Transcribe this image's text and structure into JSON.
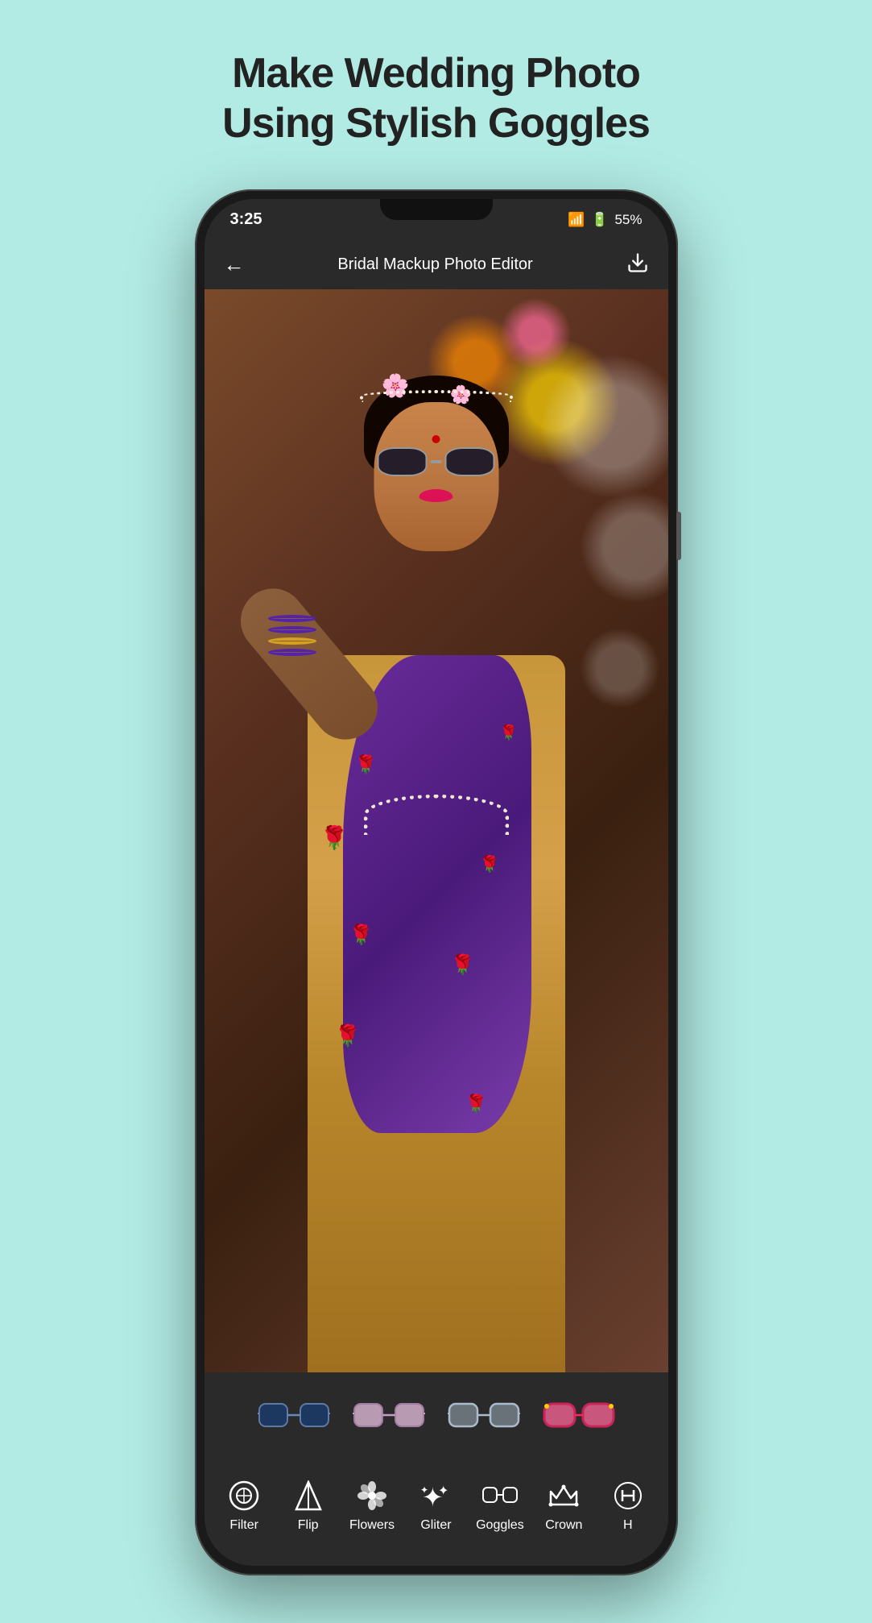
{
  "page": {
    "title_line1": "Make Wedding Photo",
    "title_line2": "Using Stylish Goggles"
  },
  "status_bar": {
    "time": "3:25",
    "signal": "📶",
    "battery": "55%"
  },
  "app_bar": {
    "title": "Bridal Mackup Photo Editor",
    "back_label": "←",
    "download_label": "⬇"
  },
  "bottom_nav": {
    "items": [
      {
        "id": "filter",
        "icon": "⊙",
        "label": "Filter"
      },
      {
        "id": "flip",
        "icon": "△",
        "label": "Flip"
      },
      {
        "id": "flowers",
        "icon": "✿",
        "label": "Flowers"
      },
      {
        "id": "glitter",
        "icon": "✦",
        "label": "Gliter"
      },
      {
        "id": "goggles",
        "icon": "👓",
        "label": "Goggles"
      },
      {
        "id": "crown",
        "icon": "♛",
        "label": "Crown"
      },
      {
        "id": "more",
        "icon": "✽",
        "label": "H"
      }
    ]
  },
  "goggles_bar": {
    "items": [
      {
        "id": "goggle1",
        "color": "#1a3a6a",
        "tint": "#4a7abf"
      },
      {
        "id": "goggle2",
        "color": "#c8a0c8",
        "tint": "#e8c8e8"
      },
      {
        "id": "goggle3",
        "color": "#ccc",
        "tint": "#eee"
      },
      {
        "id": "goggle4",
        "color": "#ff3399",
        "tint": "#ff6699"
      }
    ]
  }
}
